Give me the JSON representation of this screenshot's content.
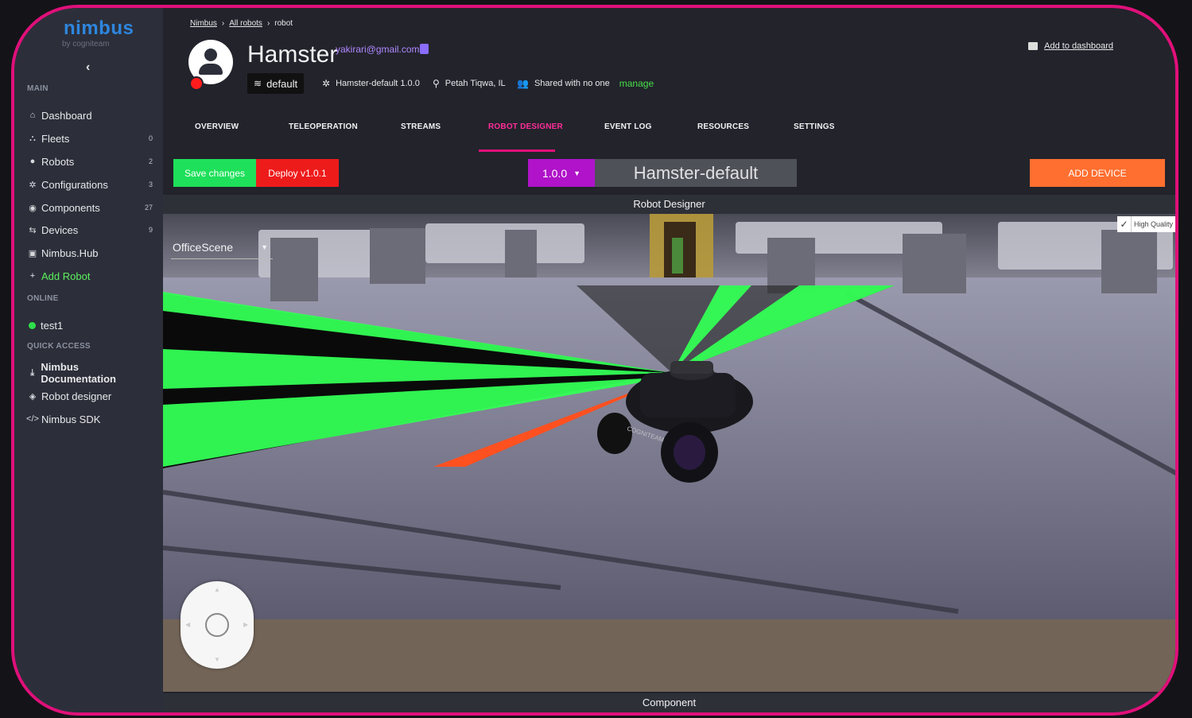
{
  "sidebar": {
    "logo": "nimbus",
    "logo_sub": "by cogniteam",
    "collapse": "‹",
    "main_label": "MAIN",
    "items": [
      {
        "label": "Dashboard",
        "count": ""
      },
      {
        "label": "Fleets",
        "count": "0"
      },
      {
        "label": "Robots",
        "count": "2"
      },
      {
        "label": "Configurations",
        "count": "3"
      },
      {
        "label": "Components",
        "count": "27"
      },
      {
        "label": "Devices",
        "count": "9"
      },
      {
        "label": "Nimbus.Hub",
        "count": ""
      },
      {
        "label": "Add Robot",
        "count": ""
      }
    ],
    "online_label": "ONLINE",
    "online": [
      {
        "label": "test1"
      }
    ],
    "quick_label": "QUICK ACCESS",
    "quick": [
      {
        "label": "Nimbus Documentation"
      },
      {
        "label": "Robot designer"
      },
      {
        "label": "Nimbus SDK"
      }
    ]
  },
  "breadcrumb": {
    "items": [
      "Nimbus",
      "All robots",
      "robot"
    ],
    "sep": "›"
  },
  "robot": {
    "name": "Hamster",
    "email": "yakirari@gmail.com",
    "branch": "default",
    "configuration": "Hamster-default 1.0.0",
    "location": "Petah Tiqwa, IL",
    "sharing": "Shared with no one",
    "manage": "manage",
    "status_color": "#ff1c1c"
  },
  "add_to_dashboard": "Add to dashboard",
  "tabs": [
    "OVERVIEW",
    "TELEOPERATION",
    "STREAMS",
    "ROBOT DESIGNER",
    "EVENT LOG",
    "RESOURCES",
    "SETTINGS"
  ],
  "active_tab": "ROBOT DESIGNER",
  "toolbar": {
    "save": "Save changes",
    "deploy": "Deploy v1.0.1",
    "version": "1.0.0",
    "config_name": "Hamster-default",
    "add_device": "ADD DEVICE"
  },
  "designer_title": "Robot Designer",
  "viewport": {
    "scene": "OfficeScene",
    "high_quality": "High Quality",
    "high_quality_checked": true,
    "robot_label": "COGNITEAM"
  },
  "component_title": "Component",
  "colors": {
    "accent": "#e0107a",
    "save": "#1ee05a",
    "deploy": "#ee1b1b",
    "version": "#b013c9",
    "add_device": "#ff6f30",
    "lidar": "#33ff55"
  }
}
